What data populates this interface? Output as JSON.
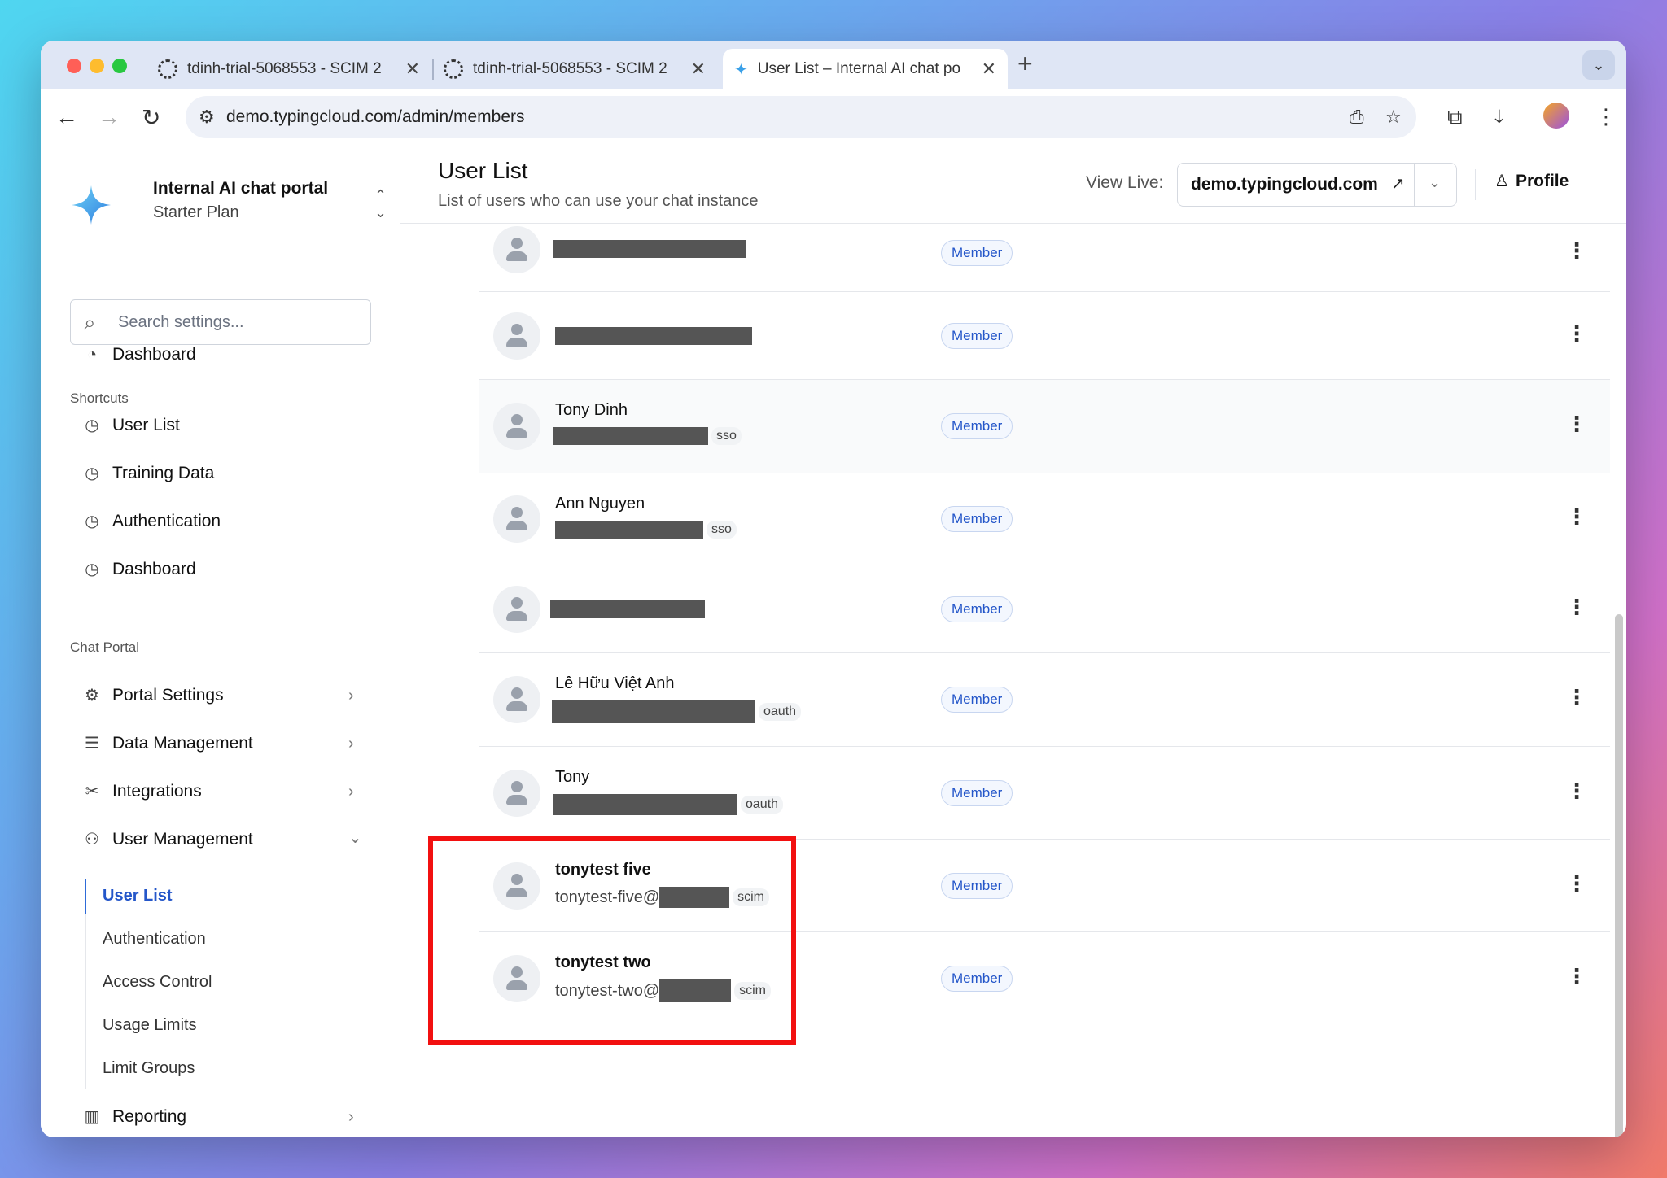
{
  "browser": {
    "tabs": [
      {
        "title": "tdinh-trial-5068553 - SCIM 2",
        "icon": "gear-icon"
      },
      {
        "title": "tdinh-trial-5068553 - SCIM 2",
        "icon": "gear-icon"
      },
      {
        "title": "User List – Internal AI chat po",
        "icon": "sparkle-icon"
      }
    ],
    "url": "demo.typingcloud.com/admin/members"
  },
  "sidebar": {
    "org_name": "Internal AI chat portal",
    "org_plan": "Starter Plan",
    "search_placeholder": "Search settings...",
    "dashboard": "Dashboard",
    "shortcuts_label": "Shortcuts",
    "shortcuts": [
      "User List",
      "Training Data",
      "Authentication",
      "Dashboard"
    ],
    "chat_portal_label": "Chat Portal",
    "sections": [
      "Portal Settings",
      "Data Management",
      "Integrations",
      "User Management"
    ],
    "user_management_items": [
      "User List",
      "Authentication",
      "Access Control",
      "Usage Limits",
      "Limit Groups"
    ],
    "reporting": "Reporting"
  },
  "header": {
    "title": "User List",
    "subtitle": "List of users who can use your chat instance",
    "view_live_label": "View Live:",
    "view_live_url": "demo.typingcloud.com",
    "profile": "Profile"
  },
  "users": [
    {
      "name": "",
      "email": "",
      "provider": "",
      "role": "Member"
    },
    {
      "name": "",
      "email": "",
      "provider": "",
      "role": "Member"
    },
    {
      "name": "Tony Dinh",
      "email": "",
      "provider": "sso",
      "role": "Member"
    },
    {
      "name": "Ann Nguyen",
      "email": "",
      "provider": "sso",
      "role": "Member"
    },
    {
      "name": "",
      "email": "",
      "provider": "",
      "role": "Member"
    },
    {
      "name": "Lê Hữu Việt Anh",
      "email": "",
      "provider": "oauth",
      "role": "Member"
    },
    {
      "name": "Tony",
      "email": "",
      "provider": "oauth",
      "role": "Member"
    },
    {
      "name": "tonytest five",
      "email": "tonytest-five@",
      "provider": "scim",
      "role": "Member"
    },
    {
      "name": "tonytest two",
      "email": "tonytest-two@",
      "provider": "scim",
      "role": "Member"
    }
  ]
}
